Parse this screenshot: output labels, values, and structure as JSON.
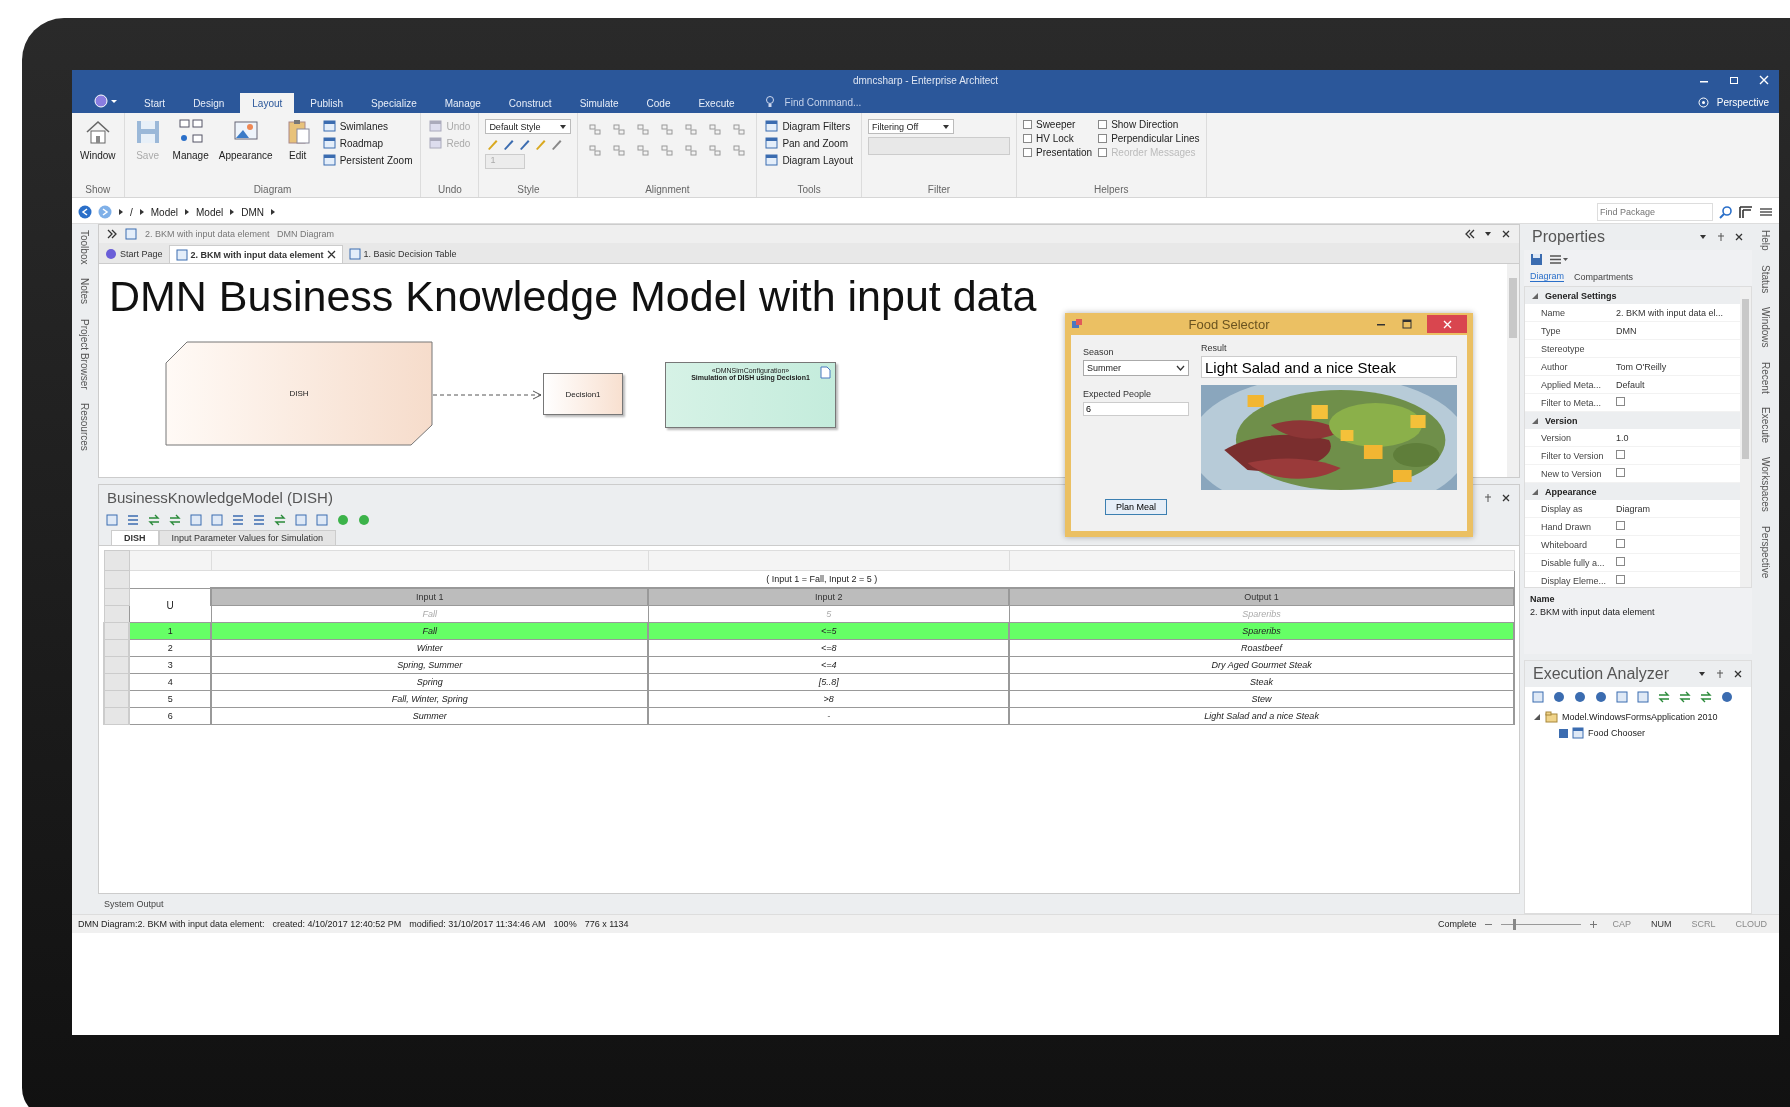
{
  "window": {
    "title": "dmncsharp - Enterprise Architect"
  },
  "ribbon_tabs": [
    {
      "label": "Start",
      "selected": false
    },
    {
      "label": "Design",
      "selected": false
    },
    {
      "label": "Layout",
      "selected": true
    },
    {
      "label": "Publish",
      "selected": false
    },
    {
      "label": "Specialize",
      "selected": false
    },
    {
      "label": "Manage",
      "selected": false
    },
    {
      "label": "Construct",
      "selected": false
    },
    {
      "label": "Simulate",
      "selected": false
    },
    {
      "label": "Code",
      "selected": false
    },
    {
      "label": "Execute",
      "selected": false
    }
  ],
  "find_command": "Find Command...",
  "perspective": "Perspective",
  "ribbon_groups": [
    {
      "label": "Show",
      "items": [
        {
          "kind": "big",
          "label": "Window",
          "disabled": false
        }
      ]
    },
    {
      "label": "Diagram",
      "items": [
        {
          "kind": "big",
          "label": "Save",
          "disabled": true
        },
        {
          "kind": "big",
          "label": "Manage",
          "disabled": false
        },
        {
          "kind": "big",
          "label": "Appearance",
          "disabled": false
        },
        {
          "kind": "big",
          "label": "Edit",
          "disabled": false
        },
        {
          "kind": "small",
          "label": "Swimlanes",
          "disabled": false
        },
        {
          "kind": "small",
          "label": "Roadmap",
          "disabled": false
        },
        {
          "kind": "small",
          "label": "Persistent Zoom",
          "disabled": false
        }
      ]
    },
    {
      "label": "Undo",
      "items": [
        {
          "kind": "small",
          "label": "Undo",
          "disabled": true
        },
        {
          "kind": "small",
          "label": "Redo",
          "disabled": true
        }
      ]
    },
    {
      "label": "Style",
      "items": [
        {
          "kind": "select",
          "label": "Default Style",
          "disabled": false
        },
        {
          "kind": "iconrow"
        },
        {
          "kind": "spin",
          "label": "1",
          "disabled": true
        }
      ]
    },
    {
      "label": "Alignment",
      "items": [
        {
          "kind": "icongrid"
        }
      ]
    },
    {
      "label": "Tools",
      "items": [
        {
          "kind": "small",
          "label": "Diagram Filters",
          "disabled": false
        },
        {
          "kind": "small",
          "label": "Pan and Zoom",
          "disabled": false
        },
        {
          "kind": "small",
          "label": "Diagram Layout",
          "disabled": false
        }
      ]
    },
    {
      "label": "Filter",
      "items": [
        {
          "kind": "select",
          "label": "Filtering Off",
          "disabled": false
        },
        {
          "kind": "field"
        }
      ]
    },
    {
      "label": "Helpers",
      "items": [
        {
          "kind": "checkbox",
          "label": "Sweeper",
          "checked": false,
          "disabled": false
        },
        {
          "kind": "checkbox",
          "label": "HV Lock",
          "checked": false,
          "disabled": false
        },
        {
          "kind": "checkbox",
          "label": "Presentation",
          "checked": false,
          "disabled": false
        },
        {
          "kind": "checkbox",
          "label": "Show Direction",
          "checked": false,
          "disabled": false
        },
        {
          "kind": "checkbox",
          "label": "Perpendicular Lines",
          "checked": false,
          "disabled": false
        },
        {
          "kind": "checkbox",
          "label": "Reorder Messages",
          "checked": false,
          "disabled": true
        }
      ]
    }
  ],
  "breadcrumb": [
    "/",
    "Model",
    "Model",
    "DMN"
  ],
  "find_package": {
    "placeholder": "Find Package"
  },
  "left_strip": [
    "Toolbox",
    "Notes",
    "Project Browser",
    "Resources"
  ],
  "right_strip": [
    "Help",
    "Status",
    "Windows",
    "Recent",
    "Execute",
    "Workspaces",
    "Perspective"
  ],
  "diagram": {
    "caption": "2. BKM with input data element   DMN Diagram",
    "tabs": [
      {
        "label": "Start Page",
        "selected": false
      },
      {
        "label": "2. BKM with input data element",
        "selected": true
      },
      {
        "label": "1. Basic Decision Table",
        "selected": false
      }
    ],
    "title": "DMN Business Knowledge Model with input data",
    "nodes": [
      {
        "kind": "bkm",
        "name": "DISH"
      },
      {
        "kind": "decision",
        "name": "Decision1"
      },
      {
        "kind": "config",
        "stereotype": "«DMNSimConfiguration»",
        "name": "Simulation of DISH using Decision1"
      }
    ]
  },
  "food_selector": {
    "title": "Food Selector",
    "season": {
      "label": "Season",
      "value": "Summer"
    },
    "people": {
      "label": "Expected People",
      "value": "6"
    },
    "result": {
      "label": "Result",
      "value": "Light Salad and a nice Steak"
    },
    "button": "Plan Meal"
  },
  "bkm": {
    "title": "BusinessKnowledgeModel (DISH)",
    "tabs": [
      {
        "label": "DISH",
        "selected": true
      },
      {
        "label": "Input Parameter Values for Simulation",
        "selected": false
      }
    ],
    "test_expression": "( Input 1 = Fall, Input 2 = 5 )",
    "hit_policy": "U",
    "columns": [
      "Input 1",
      "Input 2",
      "Output 1"
    ],
    "test_values": [
      "Fall",
      "5",
      "Spareribs"
    ],
    "rows": [
      {
        "number": "1",
        "cells": [
          "Fall",
          "<=5",
          "Spareribs"
        ],
        "selected": true
      },
      {
        "number": "2",
        "cells": [
          "Winter",
          "<=8",
          "Roastbeef"
        ],
        "selected": false
      },
      {
        "number": "3",
        "cells": [
          "Spring, Summer",
          "<=4",
          "Dry Aged Gourmet Steak"
        ],
        "selected": false
      },
      {
        "number": "4",
        "cells": [
          "Spring",
          "[5..8]",
          "Steak"
        ],
        "selected": false
      },
      {
        "number": "5",
        "cells": [
          "Fall, Winter, Spring",
          ">8",
          "Stew"
        ],
        "selected": false
      },
      {
        "number": "6",
        "cells": [
          "Summer",
          "-",
          "Light Salad and a nice Steak"
        ],
        "selected": false
      }
    ]
  },
  "system_output": "System Output",
  "properties": {
    "title": "Properties",
    "tabs": [
      {
        "label": "Diagram",
        "selected": true
      },
      {
        "label": "Compartments",
        "selected": false
      }
    ],
    "sections": [
      {
        "title": "General Settings",
        "expanded": true,
        "rows": [
          {
            "kind": "text",
            "label": "Name",
            "value": "2. BKM with input data el..."
          },
          {
            "kind": "text",
            "label": "Type",
            "value": "DMN"
          },
          {
            "kind": "text",
            "label": "Stereotype"
          },
          {
            "kind": "text",
            "label": "Author",
            "value": "Tom O'Reilly"
          },
          {
            "kind": "text",
            "label": "Applied Meta...",
            "value": "Default"
          },
          {
            "kind": "checkbox",
            "label": "Filter to Meta...",
            "checked": false
          }
        ]
      },
      {
        "title": "Version",
        "expanded": true,
        "rows": [
          {
            "kind": "text",
            "label": "Version",
            "value": "1.0"
          },
          {
            "kind": "checkbox",
            "label": "Filter to Version",
            "checked": false
          },
          {
            "kind": "checkbox",
            "label": "New to Version",
            "checked": false
          }
        ]
      },
      {
        "title": "Appearance",
        "expanded": true,
        "rows": [
          {
            "kind": "text",
            "label": "Display as",
            "value": "Diagram"
          },
          {
            "kind": "checkbox",
            "label": "Hand Drawn",
            "checked": false
          },
          {
            "kind": "checkbox",
            "label": "Whiteboard",
            "checked": false
          },
          {
            "kind": "checkbox",
            "label": "Disable fully a...",
            "checked": false
          },
          {
            "kind": "checkbox",
            "label": "Display Eleme...",
            "checked": false
          }
        ]
      }
    ],
    "footer_label": "Name",
    "footer_value": "2. BKM with input data element"
  },
  "execution_analyzer": {
    "title": "Execution Analyzer",
    "tree": [
      {
        "label": "Model.WindowsFormsApplication 2010",
        "expanded": true,
        "children": [
          {
            "label": "Food Chooser",
            "checked": true
          }
        ]
      }
    ]
  },
  "status_bar": {
    "parts": [
      "DMN Diagram:2. BKM with input data element:",
      "created: 4/10/2017 12:40:52 PM",
      "modified: 31/10/2017 11:34:46 AM",
      "100%",
      "776 x 1134"
    ],
    "state": "Complete",
    "zoom": {
      "level": 0.15
    },
    "indicators": [
      {
        "label": "CAP",
        "on": false
      },
      {
        "label": "NUM",
        "on": true
      },
      {
        "label": "SCRL",
        "on": false
      },
      {
        "label": "CLOUD",
        "on": false
      }
    ]
  }
}
